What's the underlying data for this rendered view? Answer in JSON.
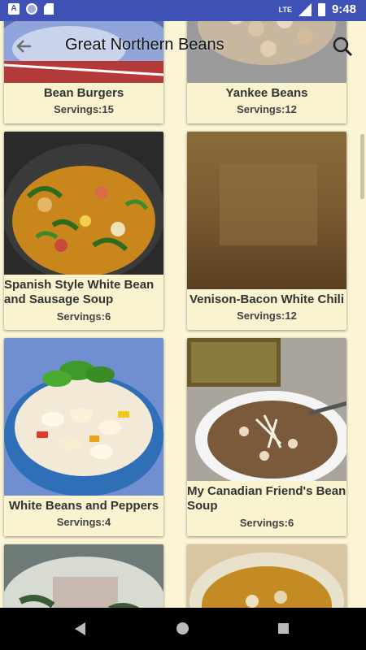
{
  "status_bar": {
    "time": "9:48",
    "network": "LTE"
  },
  "app_bar": {
    "title": "Great Northern Beans"
  },
  "recipes": [
    {
      "title": "Bean Burgers",
      "servings": "Servings:15"
    },
    {
      "title": "Yankee Beans",
      "servings": "Servings:12"
    },
    {
      "title": "Spanish Style White Bean and Sausage Soup",
      "servings": "Servings:6"
    },
    {
      "title": "Venison-Bacon White Chili",
      "servings": "Servings:12"
    },
    {
      "title": "White Beans and Peppers",
      "servings": "Servings:4"
    },
    {
      "title": "My Canadian Friend's Bean Soup",
      "servings": "Servings:6"
    },
    {
      "title": "",
      "servings": ""
    },
    {
      "title": "",
      "servings": ""
    }
  ],
  "colors": {
    "status_bar": "#3f51b5",
    "background": "#fbf5d6",
    "card": "#f9f3d0"
  }
}
